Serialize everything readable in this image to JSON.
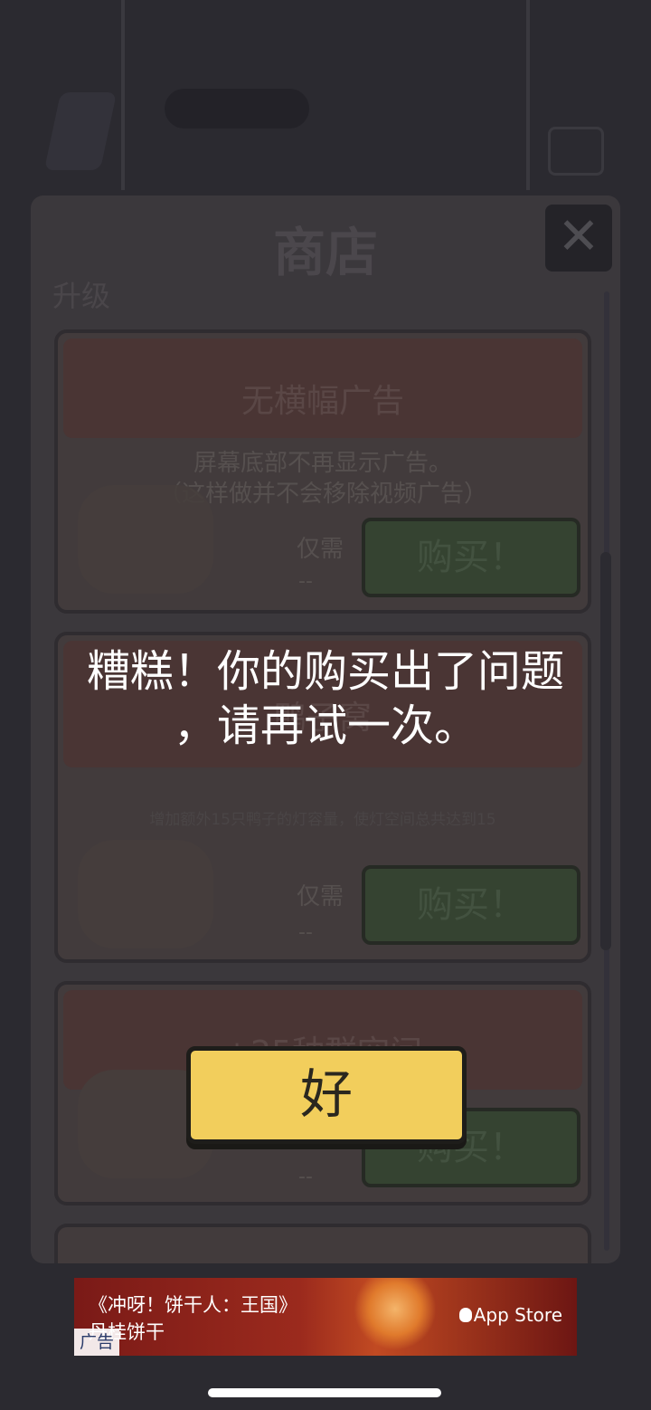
{
  "shop": {
    "title": "商店",
    "close_glyph": "✕",
    "section_label": "升级",
    "cards": [
      {
        "title": "无横幅广告",
        "desc_line1": "屏幕底部不再显示广告。",
        "desc_line2": "（这样做并不会移除视频广告）",
        "price_label": "仅需",
        "price_value": "--",
        "buy_label": "购买！"
      },
      {
        "title": "鸭子窝",
        "desc_line1": "增加额外15只鸭子的灯容量，使灯空间总共达到15",
        "price_label": "仅需",
        "price_value": "--",
        "buy_label": "购买！"
      },
      {
        "title": "+25种群空间",
        "price_value": "--",
        "buy_label": "购买！"
      }
    ]
  },
  "alert": {
    "message_line1": "糟糕！你的购买出了问题",
    "message_line2": "，请再试一次。",
    "ok_label": "好"
  },
  "ad": {
    "title": "《冲呀！饼干人：王国》",
    "subtitle": "丹桂饼干",
    "tag": "广告",
    "store_label": "App Store"
  },
  "colors": {
    "ok_button": "#f2ce5c",
    "overlay": "#2b2a30"
  }
}
